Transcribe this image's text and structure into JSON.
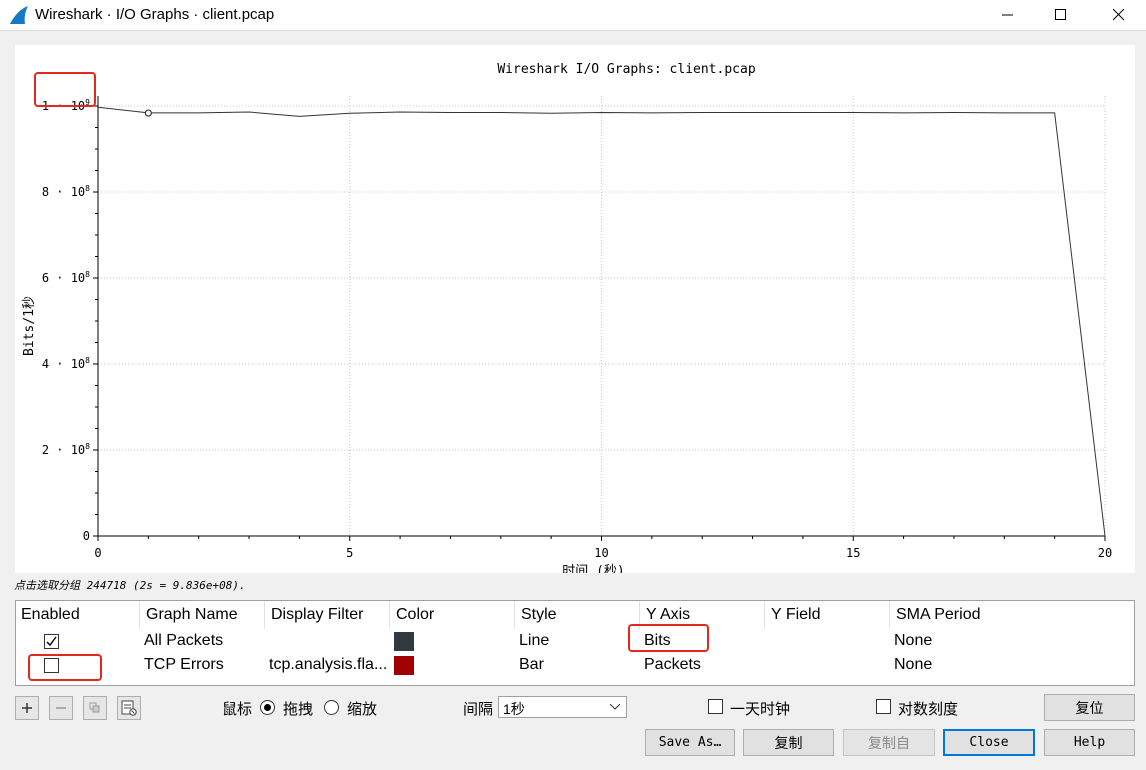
{
  "window": {
    "title": "Wireshark · I/O Graphs · client.pcap"
  },
  "chart_data": {
    "type": "line",
    "title": "Wireshark I/O Graphs: client.pcap",
    "xlabel": "时间 (秒)",
    "ylabel": "Bits/1秒",
    "xlim": [
      0,
      20
    ],
    "ylim": [
      0,
      1000000000
    ],
    "x_ticks": [
      "0",
      "5",
      "10",
      "15",
      "20"
    ],
    "y_ticks": [
      {
        "value": 0,
        "mant": "0",
        "exp": ""
      },
      {
        "value": 200000000,
        "mant": "2 · 10",
        "exp": "8"
      },
      {
        "value": 400000000,
        "mant": "4 · 10",
        "exp": "8"
      },
      {
        "value": 600000000,
        "mant": "6 · 10",
        "exp": "8"
      },
      {
        "value": 800000000,
        "mant": "8 · 10",
        "exp": "8"
      },
      {
        "value": 1000000000,
        "mant": "1 · 10",
        "exp": "9"
      }
    ],
    "grid": true,
    "series": [
      {
        "name": "All Packets",
        "color": "#333333",
        "x": [
          0,
          1,
          2,
          3,
          4,
          5,
          6,
          7,
          8,
          9,
          10,
          11,
          12,
          13,
          14,
          15,
          16,
          17,
          18,
          19,
          20
        ],
        "y": [
          997000000,
          984000000,
          984000000,
          986000000,
          976000000,
          983000000,
          986000000,
          985000000,
          985000000,
          983000000,
          985000000,
          984000000,
          985000000,
          985000000,
          985000000,
          985000000,
          984000000,
          985000000,
          984000000,
          984000000,
          0
        ]
      }
    ],
    "selected_point": {
      "x": 1,
      "y": 983600000
    }
  },
  "hint_text": "点击选取分组 244718 (2s = 9.836e+08).",
  "table": {
    "headers": [
      "Enabled",
      "Graph Name",
      "Display Filter",
      "Color",
      "Style",
      "Y Axis",
      "Y Field",
      "SMA Period"
    ],
    "rows": [
      {
        "enabled": true,
        "name": "All Packets",
        "filter": "",
        "color": "#333a3f",
        "style": "Line",
        "y_axis": "Bits",
        "y_field": "",
        "sma": "None"
      },
      {
        "enabled": false,
        "name": "TCP Errors",
        "filter": "tcp.analysis.fla...",
        "color": "#a10000",
        "style": "Bar",
        "y_axis": "Packets",
        "y_field": "",
        "sma": "None"
      }
    ]
  },
  "controls": {
    "mouse_label": "鼠标",
    "drag_label": "拖拽",
    "zoom_label": "缩放",
    "mouse_mode": "drag",
    "interval_label": "间隔",
    "interval_value": "1秒",
    "time_of_day_label": "一天时钟",
    "time_of_day": false,
    "log_scale_label": "对数刻度",
    "log_scale": false
  },
  "buttons": {
    "reset": "复位",
    "save_as": "Save As…",
    "copy": "复制",
    "copy_from": "复制自",
    "close": "Close",
    "help": "Help"
  }
}
